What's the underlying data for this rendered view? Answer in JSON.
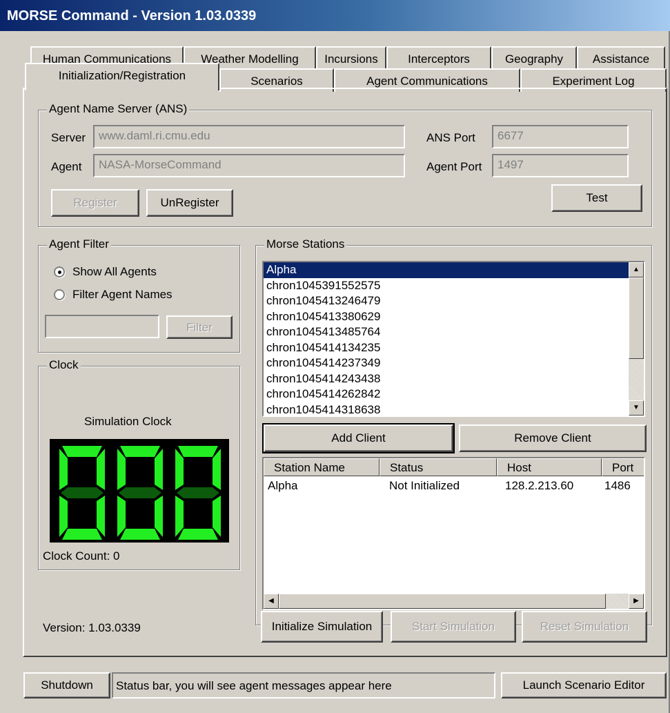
{
  "window": {
    "title": "MORSE Command - Version 1.03.0339"
  },
  "tabs": {
    "row1": [
      "Human Communications",
      "Weather Modelling",
      "Incursions",
      "Interceptors",
      "Geography",
      "Assistance"
    ],
    "row2": [
      "Initialization/Registration",
      "Scenarios",
      "Agent Communications",
      "Experiment Log"
    ],
    "active": "Initialization/Registration"
  },
  "ans": {
    "group_title": "Agent Name Server (ANS)",
    "server_label": "Server",
    "server_value": "www.daml.ri.cmu.edu",
    "agent_label": "Agent",
    "agent_value": "NASA-MorseCommand",
    "ans_port_label": "ANS Port",
    "ans_port_value": "6677",
    "agent_port_label": "Agent Port",
    "agent_port_value": "1497",
    "register_label": "Register",
    "unregister_label": "UnRegister",
    "test_label": "Test"
  },
  "filter": {
    "group_title": "Agent Filter",
    "show_all_label": "Show All Agents",
    "filter_names_label": "Filter Agent Names",
    "selected": "Show All Agents",
    "input_value": "",
    "filter_button_label": "Filter"
  },
  "clock": {
    "group_title": "Clock",
    "caption": "Simulation Clock",
    "count_text": "Clock Count: 0"
  },
  "stations": {
    "group_title": "Morse Stations",
    "items": [
      "Alpha",
      "chron1045391552575",
      "chron1045413246479",
      "chron1045413380629",
      "chron1045413485764",
      "chron1045414134235",
      "chron1045414237349",
      "chron1045414243438",
      "chron1045414262842",
      "chron1045414318638"
    ],
    "selected": "Alpha",
    "add_client_label": "Add Client",
    "remove_client_label": "Remove Client"
  },
  "table": {
    "columns": [
      "Station Name",
      "Status",
      "Host",
      "Port"
    ],
    "rows": [
      [
        "Alpha",
        "Not Initialized",
        "128.2.213.60",
        "1486"
      ]
    ]
  },
  "simulation": {
    "initialize_label": "Initialize Simulation",
    "start_label": "Start Simulation",
    "reset_label": "Reset Simulation"
  },
  "version_text": "Version: 1.03.0339",
  "bottom": {
    "shutdown_label": "Shutdown",
    "status_text": "Status bar, you will see agent messages appear here",
    "launch_label": "Launch Scenario Editor"
  },
  "colors": {
    "selection": "#0a246a",
    "digit_on": "#22ee22",
    "digit_dim": "#0c5a0c",
    "face": "#d4d0c8"
  }
}
